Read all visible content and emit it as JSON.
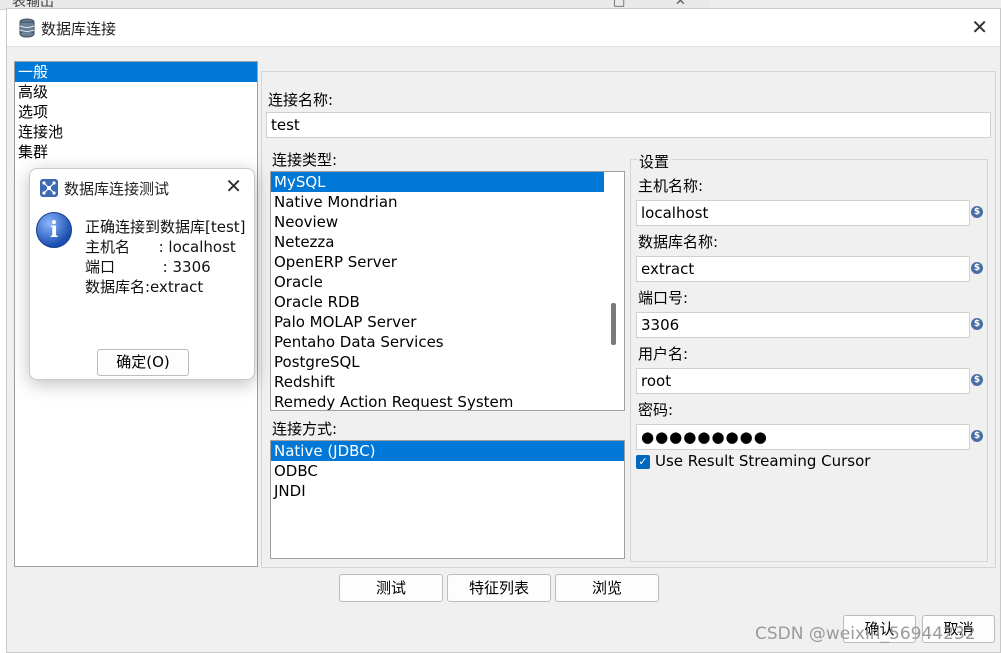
{
  "background": {
    "title": "表输出",
    "controls": [
      "□",
      "✕"
    ]
  },
  "window": {
    "title": "数据库连接",
    "close_glyph": "✕"
  },
  "nav": {
    "items": [
      "一般",
      "高级",
      "选项",
      "连接池",
      "集群"
    ],
    "selected": 0
  },
  "form": {
    "connection_name_label": "连接名称:",
    "connection_name_value": "test",
    "connection_type_label": "连接类型:",
    "connection_types": [
      "MySQL",
      "Native Mondrian",
      "Neoview",
      "Netezza",
      "OpenERP Server",
      "Oracle",
      "Oracle RDB",
      "Palo MOLAP Server",
      "Pentaho Data Services",
      "PostgreSQL",
      "Redshift",
      "Remedy Action Request System"
    ],
    "connection_type_selected": 0,
    "access_label": "连接方式:",
    "access_methods": [
      "Native (JDBC)",
      "ODBC",
      "JNDI"
    ],
    "access_selected": 0
  },
  "settings": {
    "legend": "设置",
    "host_label": "主机名称:",
    "host_value": "localhost",
    "db_label": "数据库名称:",
    "db_value": "extract",
    "port_label": "端口号:",
    "port_value": "3306",
    "user_label": "用户名:",
    "user_value": "root",
    "password_label": "密码:",
    "password_value": "●●●●●●●●●",
    "streaming_label": "Use Result Streaming Cursor",
    "streaming_checked": true
  },
  "buttons": {
    "test": "测试",
    "features": "特征列表",
    "browse": "浏览",
    "ok": "确认",
    "cancel": "取消"
  },
  "popup": {
    "title": "数据库连接测试",
    "close_glyph": "✕",
    "info_glyph": "i",
    "line1": "正确连接到数据库[test]",
    "line2": "主机名      : localhost",
    "line3": "端口          : 3306",
    "line4": "数据库名:extract",
    "ok_label": "确定(O)"
  },
  "watermark": "CSDN @weixin_56944232"
}
